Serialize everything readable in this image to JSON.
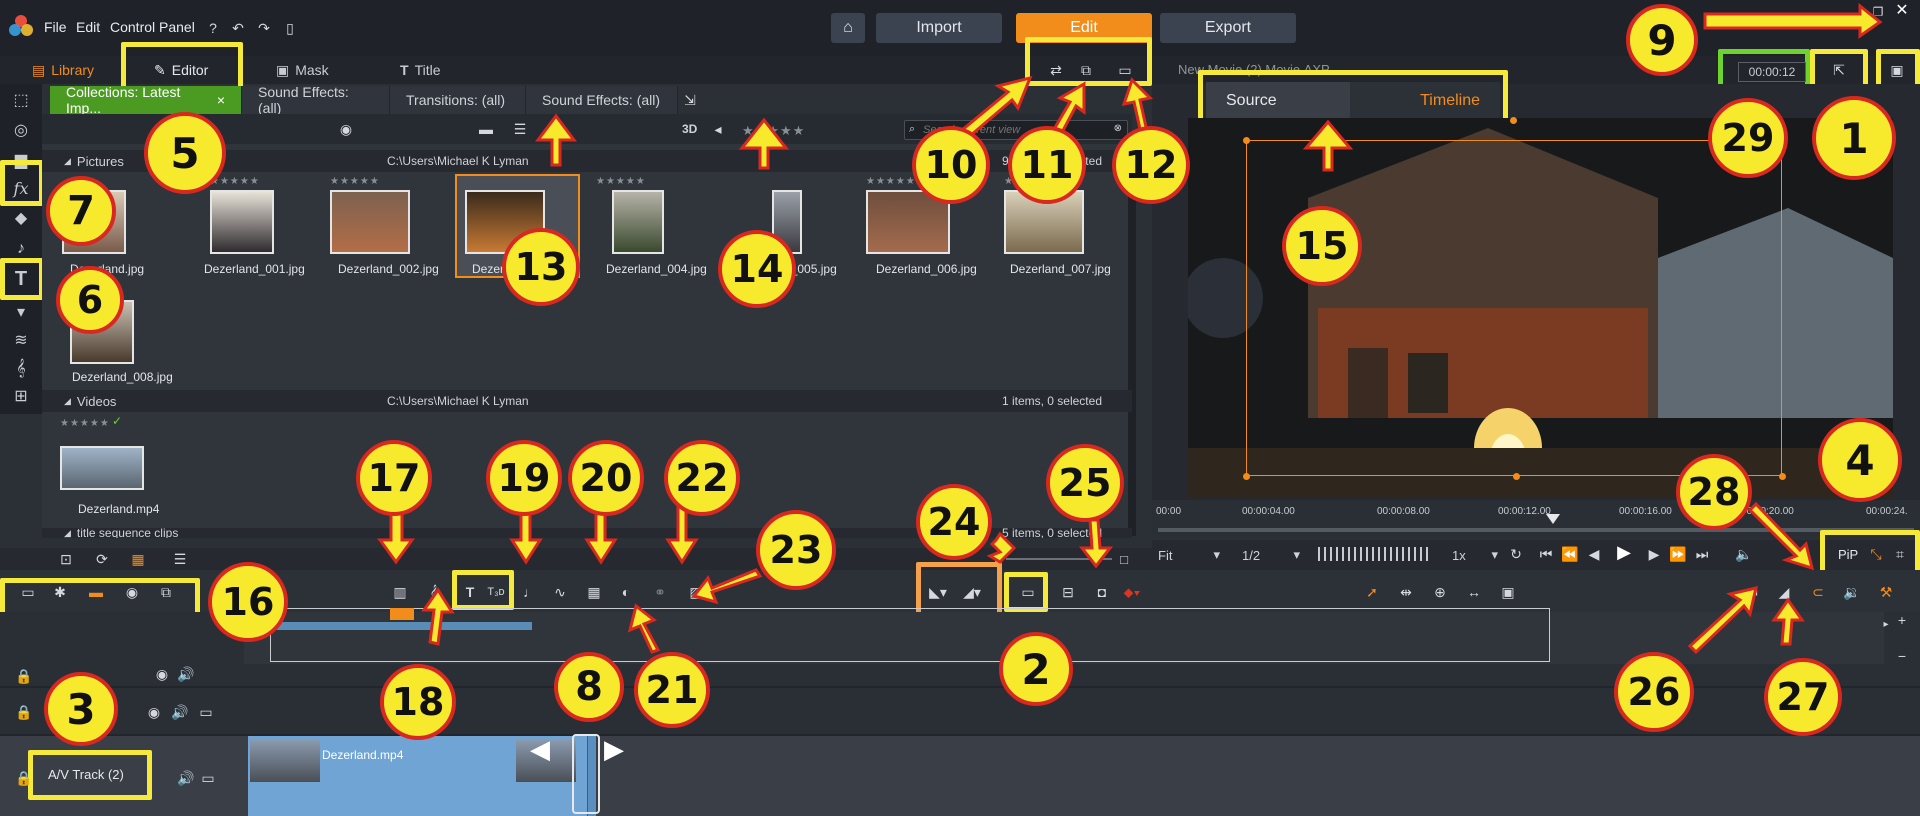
{
  "menu": [
    "File",
    "Edit",
    "Control Panel"
  ],
  "modes": {
    "import": "Import",
    "edit": "Edit",
    "export": "Export"
  },
  "libtabs": {
    "library": "Library",
    "editor": "Editor",
    "mask": "Mask",
    "title": "Title"
  },
  "project_title": "New Movie (2) Movie.AXP",
  "timecode": "00:00:12",
  "coll_tabs": [
    "Collections: Latest Imp...",
    "Sound Effects: (all)",
    "Transitions: (all)",
    "Sound Effects: (all)"
  ],
  "search_placeholder": "Search current view",
  "label_3d": "3D",
  "pictures": {
    "title": "Pictures",
    "path": "C:\\Users\\Michael K Lyman",
    "status": "9 items, 1 selected",
    "items": [
      "Dezerland.jpg",
      "Dezerland_001.jpg",
      "Dezerland_002.jpg",
      "Dezerland_003.jpg",
      "Dezerland_004.jpg",
      "Dezerland_005.jpg",
      "Dezerland_006.jpg",
      "Dezerland_007.jpg",
      "Dezerland_008.jpg"
    ]
  },
  "videos": {
    "title": "Videos",
    "path": "C:\\Users\\Michael K Lyman",
    "status": "1 items, 0 selected",
    "items": [
      "Dezerland.mp4"
    ]
  },
  "title_seq": {
    "title": "title sequence clips",
    "status": "5 items, 0 selected"
  },
  "preview_tabs": {
    "source": "Source",
    "timeline": "Timeline"
  },
  "ruler": [
    "00:00",
    "00:00:04.00",
    "00:00:08.00",
    "00:00:12.00",
    "00:00:16.00",
    "00:00:20.00",
    "00:00:24."
  ],
  "fit": "Fit",
  "fraction": "1/2",
  "speed": "1x",
  "pip": "PiP",
  "track": {
    "label": "A/V Track (2)",
    "clip": "Dezerland.mp4"
  },
  "callouts": [
    "1",
    "2",
    "3",
    "4",
    "5",
    "6",
    "7",
    "8",
    "9",
    "10",
    "11",
    "12",
    "13",
    "14",
    "15",
    "16",
    "17",
    "18",
    "19",
    "20",
    "21",
    "22",
    "23",
    "24",
    "25",
    "26",
    "27",
    "28",
    "29"
  ],
  "colors": {
    "accent": "#f28c1b",
    "callout_fill": "#f7ea2d",
    "callout_border": "#d8281f",
    "highlight": "#f5ea3a"
  }
}
